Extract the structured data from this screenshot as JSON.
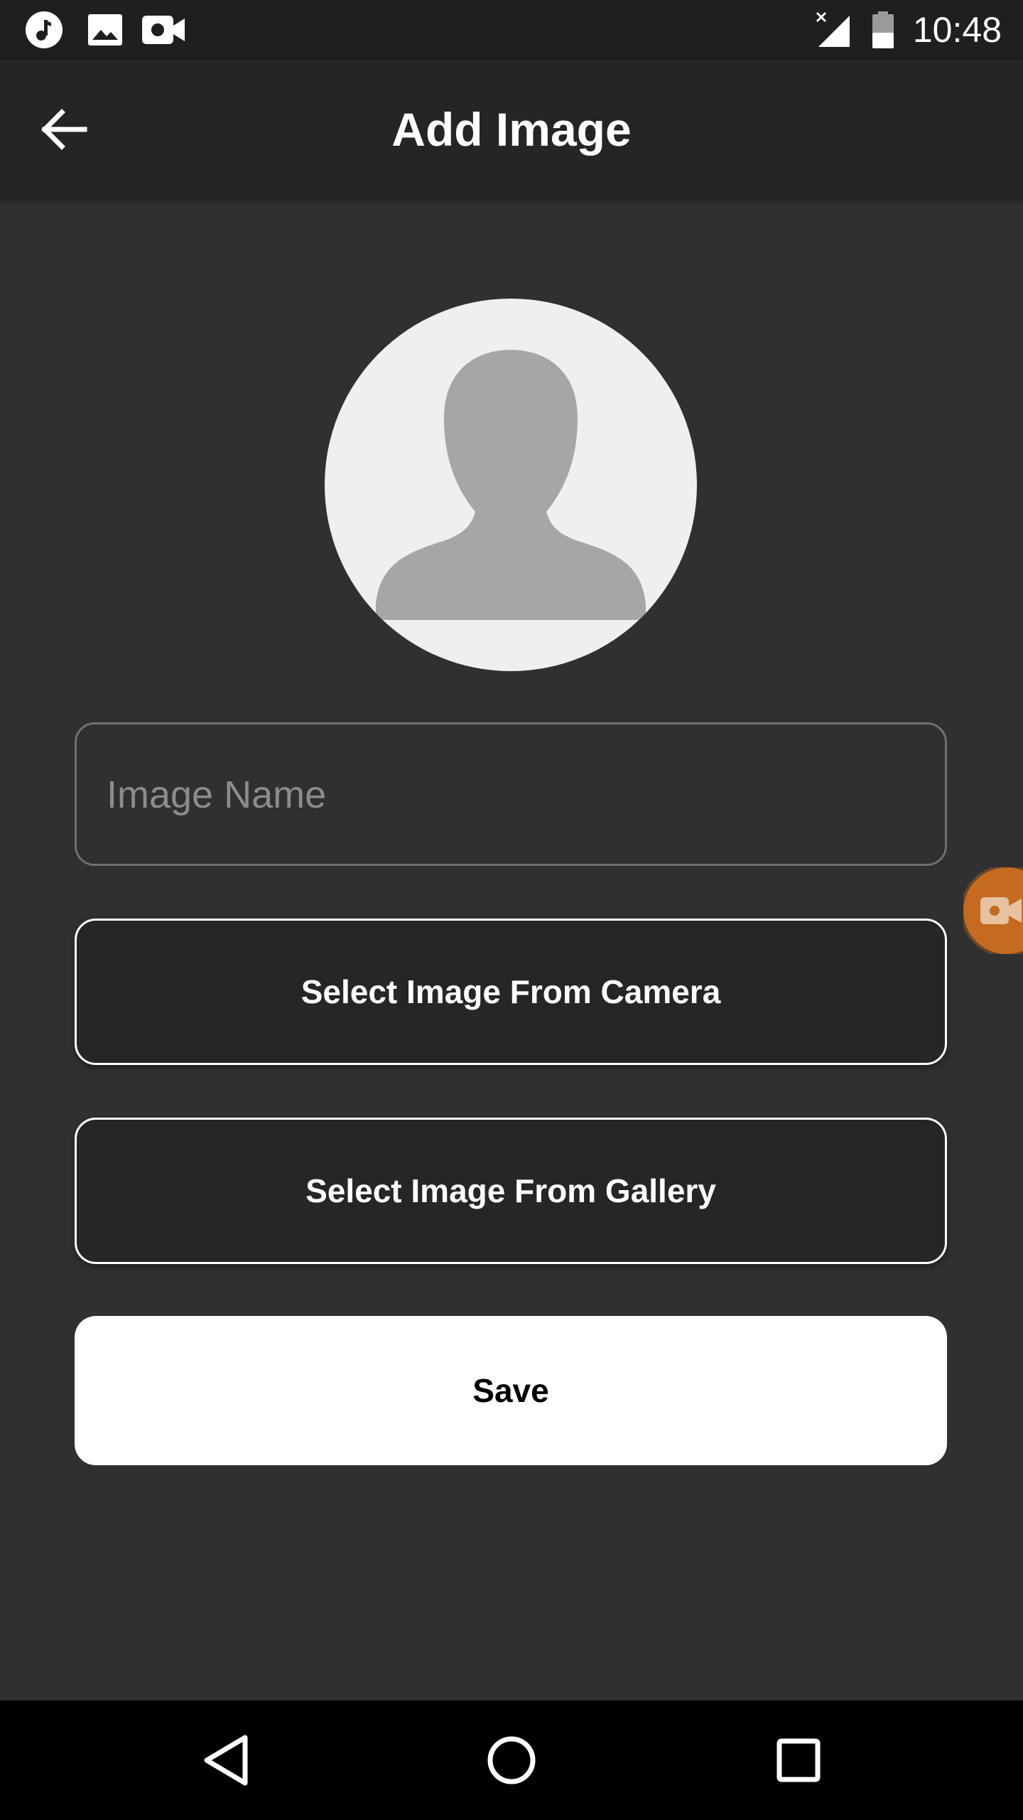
{
  "status_bar": {
    "time": "10:48",
    "left_icons": [
      "music-note-icon",
      "image-icon",
      "video-camera-icon"
    ],
    "right_icons": [
      "signal-no-data-icon",
      "battery-icon"
    ]
  },
  "app_bar": {
    "title": "Add Image",
    "back_icon": "arrow-left-icon"
  },
  "avatar": {
    "icon": "person-silhouette-icon"
  },
  "form": {
    "image_name_placeholder": "Image Name",
    "image_name_value": ""
  },
  "buttons": {
    "camera_label": "Select Image From Camera",
    "gallery_label": "Select Image From Gallery",
    "save_label": "Save"
  },
  "floating": {
    "icon": "video-camera-icon",
    "color": "#c46a21"
  },
  "nav_bar": {
    "icons": [
      "back-triangle-icon",
      "home-circle-icon",
      "recents-square-icon"
    ]
  }
}
